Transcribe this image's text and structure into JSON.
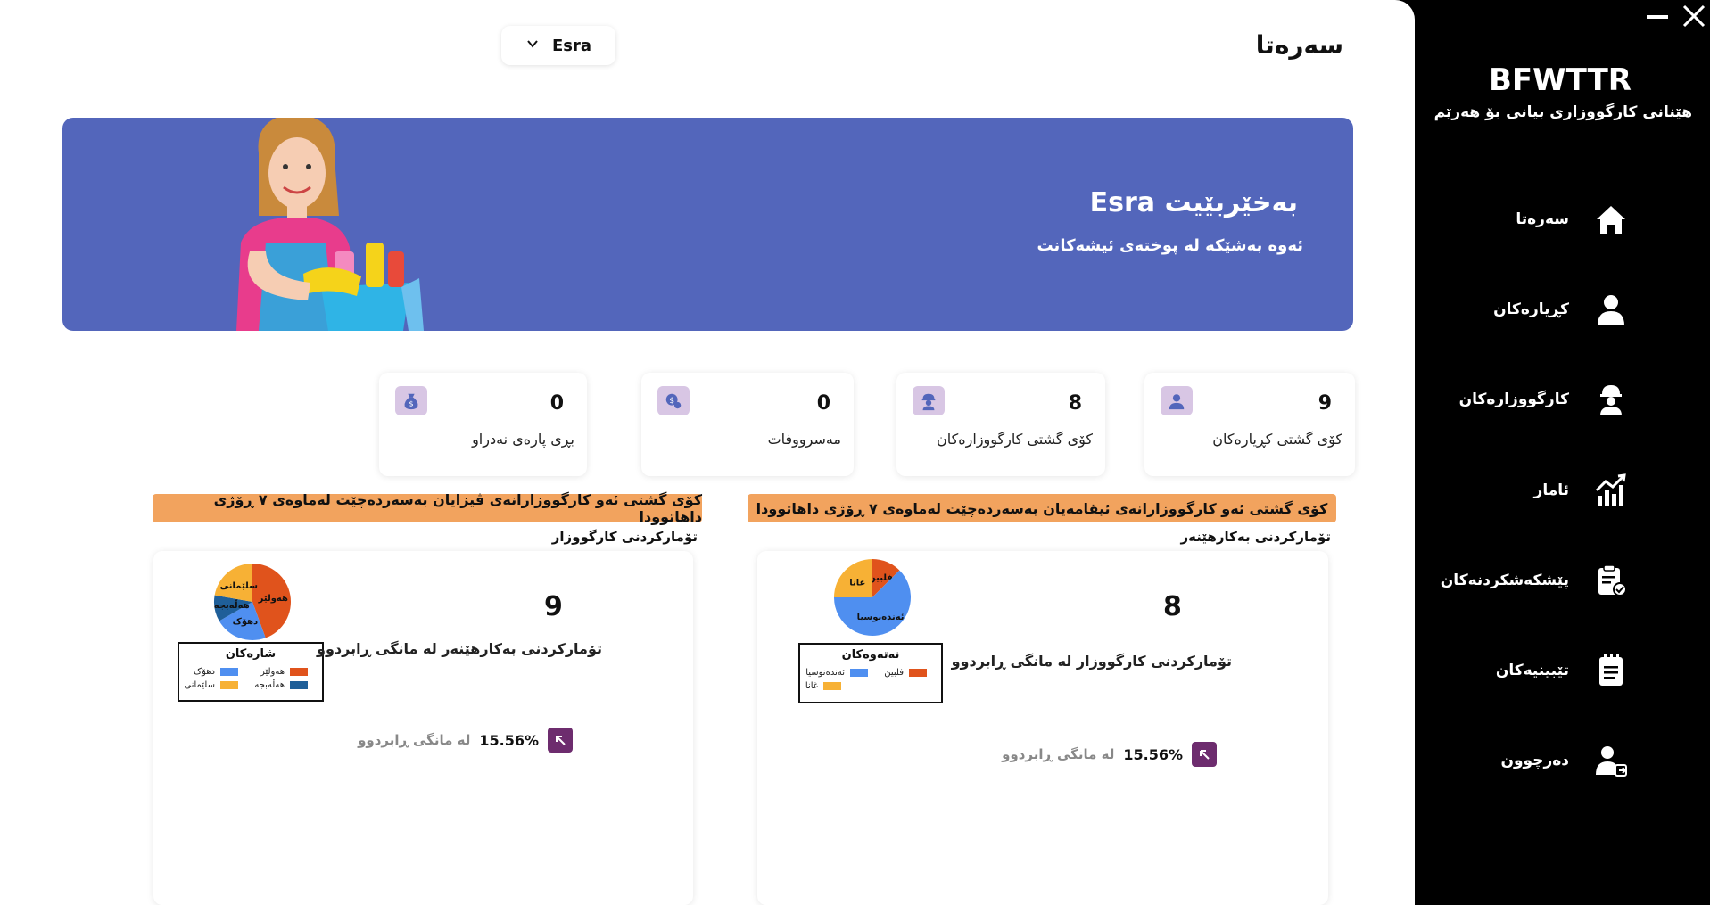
{
  "window": {
    "minimize_label": "minimize",
    "close_label": "close"
  },
  "sidebar": {
    "brand": "BFWTTR",
    "brand_sub": "هێنانی کارگووزاری بیانی بۆ هەرێم",
    "items": [
      {
        "label": "سەرەتا",
        "icon": "home-icon"
      },
      {
        "label": "کڕیارەکان",
        "icon": "user-icon"
      },
      {
        "label": "کارگووزارەکان",
        "icon": "worker-icon"
      },
      {
        "label": "ئامار",
        "icon": "chart-icon"
      },
      {
        "label": "پێشکەشکردنەکان",
        "icon": "clipboard-check-icon"
      },
      {
        "label": "تێبینیەکان",
        "icon": "notes-icon"
      },
      {
        "label": "دەرچوون",
        "icon": "logout-icon"
      }
    ]
  },
  "header": {
    "title": "سەرەتا",
    "user_select": "Esra"
  },
  "banner": {
    "title": "بەخێربێیت Esra",
    "subtitle": "ئەوە بەشێکە لە پوختەی ئیشەکانت",
    "color": "#5366bb"
  },
  "stats": [
    {
      "value": "9",
      "label": "کۆی گشتی کڕیارەکان",
      "icon": "user-icon"
    },
    {
      "value": "8",
      "label": "کۆی گشتی کارگووزارەکان",
      "icon": "worker-icon"
    },
    {
      "value": "0",
      "label": "مەسرووفات",
      "icon": "money-icon"
    },
    {
      "value": "0",
      "label": "بڕی پارەی نەدراو",
      "icon": "money-bag-icon"
    }
  ],
  "panels": {
    "right": {
      "header": "کۆی گشتی ئەو کارگووزارانەی ئیقامەیان بەسەردەچێت لەماوەی ٧ ڕۆژی داهاتوودا",
      "subtitle": "تۆمارکردنی بەکارهێنەر",
      "value": "8",
      "desc": "تۆمارکردنی کارگووزار لە مانگی ڕابردوو",
      "trend_pct": "15.56%",
      "trend_text": "لە مانگی ڕابردوو"
    },
    "left": {
      "header": "کۆی گشتی ئەو کارگووزارانەی ڤیزایان بەسەردەچێت لەماوەی ٧ ڕۆژی داهاتوودا",
      "subtitle": "تۆمارکردنی کارگووزار",
      "value": "9",
      "desc": "تۆمارکردنی بەکارهێنەر لە مانگی ڕابردوو",
      "trend_pct": "15.56%",
      "trend_text": "لە مانگی ڕابردوو"
    }
  },
  "chart_data": [
    {
      "type": "pie",
      "title": "نەتەوەکان",
      "categories": [
        "فلبین",
        "ئەندەنوسیا",
        "غانا"
      ],
      "values": [
        1,
        5,
        2
      ],
      "colors": [
        "#e0531c",
        "#4f8ff0",
        "#f7b135"
      ],
      "legend": "bottom"
    },
    {
      "type": "pie",
      "title": "شارەکان",
      "categories": [
        "هەولێر",
        "دهۆک",
        "هەڵەبجە",
        "سلێمانی"
      ],
      "values": [
        4,
        2,
        1,
        2
      ],
      "colors": [
        "#e0531c",
        "#4f8ff0",
        "#1f5f99",
        "#f7b135"
      ],
      "legend": "bottom"
    }
  ]
}
